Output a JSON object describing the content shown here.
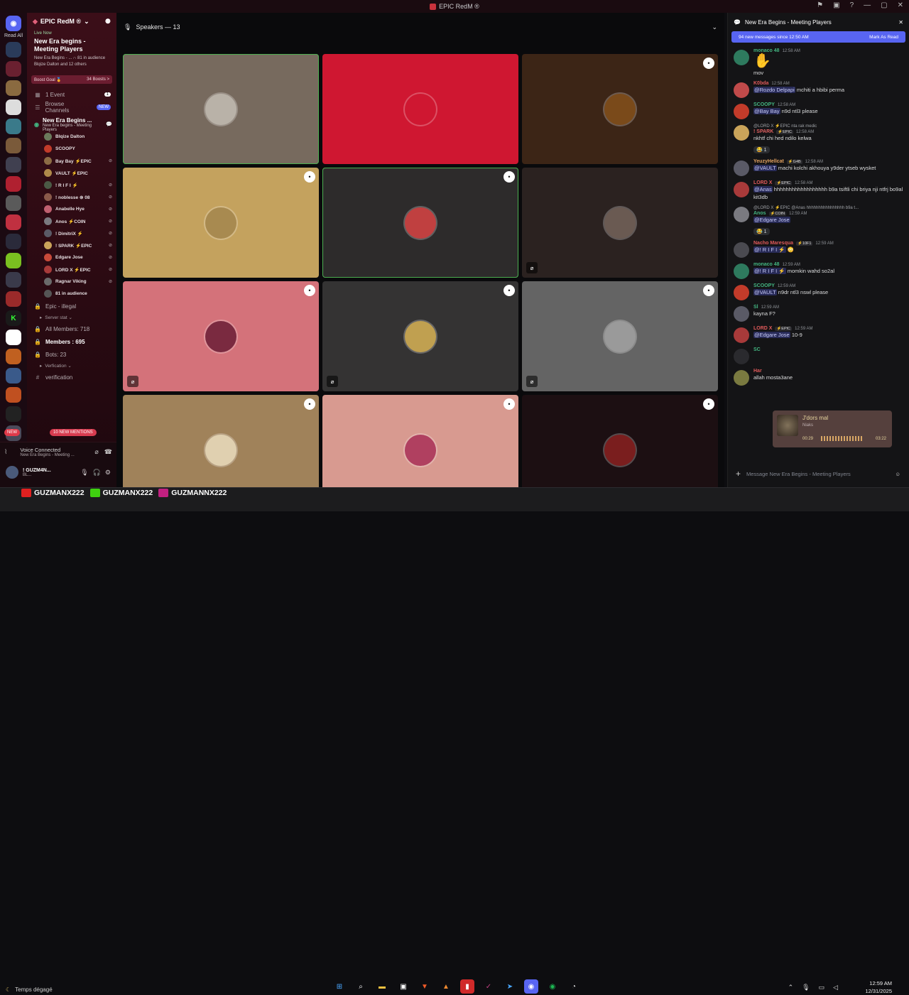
{
  "app": {
    "title": "EPIC RedM ®"
  },
  "guilds": {
    "read_all": "Read All"
  },
  "server": {
    "name": "EPIC RedM ®",
    "live": {
      "tag": "Live Now",
      "title": "New Era begins - Meeting Players",
      "meta": "New Era Begins - ... ∩ 81 in audience",
      "hosts": "Blqize Dalton and 12 others"
    },
    "boost": {
      "label": "Boost Goal 🏅",
      "count": "34 Boosts >"
    },
    "events": {
      "label": "1 Event",
      "count": "1"
    },
    "browse": {
      "label": "Browse Channels",
      "badge": "NEW"
    },
    "voice_channel": {
      "name": "New Era Begins ...",
      "sub": "New Era begins - Meeting Players"
    },
    "members": [
      {
        "name": "Blqize Dalton",
        "color": "#6b7a5c",
        "icons": ""
      },
      {
        "name": "SCOOPY",
        "color": "#c23b2a",
        "icons": ""
      },
      {
        "name": "Bay Bay ⚡EPIC",
        "color": "#8c6c45",
        "icons": "⊘"
      },
      {
        "name": "VAULT ⚡EPIC",
        "color": "#b08a4a",
        "icons": ""
      },
      {
        "name": "! R I F I ⚡",
        "color": "#4b5a45",
        "icons": "⊘"
      },
      {
        "name": "! noblesse ⊚ 08",
        "color": "#8a5a4a",
        "icons": "⊘"
      },
      {
        "name": "Anabelle Hye",
        "color": "#c06070",
        "icons": "⊘"
      },
      {
        "name": "Anos ⚡COIN",
        "color": "#7a7a80",
        "icons": "⊘"
      },
      {
        "name": "! DimitriX ⚡",
        "color": "#5a5a66",
        "icons": "⊘"
      },
      {
        "name": "! SPARK ⚡EPIC",
        "color": "#caa45a",
        "icons": "⊘"
      },
      {
        "name": "Edgare Jose",
        "color": "#c84a3a",
        "icons": "⊘"
      },
      {
        "name": "LORD X ⚡EPIC",
        "color": "#a83a3a",
        "icons": "⊘"
      },
      {
        "name": "Ragnar Viking",
        "color": "#6a6a6a",
        "icons": "⊘"
      },
      {
        "name": "81 in audience",
        "color": "#555",
        "icons": ""
      }
    ],
    "channels_below": [
      {
        "icon": "🔒",
        "label": "Epic - illegal"
      },
      {
        "icon": "▸",
        "label": "Server stat ⌄",
        "cat": true
      },
      {
        "icon": "🔒",
        "label": "All Members: 718"
      },
      {
        "icon": "🔒",
        "label": "Members : 695",
        "bold": true
      },
      {
        "icon": "🔒",
        "label": "Bots: 23"
      },
      {
        "icon": "▸",
        "label": "Verfication ⌄",
        "cat": true
      },
      {
        "icon": "#",
        "label": "verification"
      }
    ],
    "new_badge": "NEW",
    "mentions": "10 NEW MENTIONS"
  },
  "voice": {
    "status": "Voice Connected",
    "channel": "New Era Begins - Meeting ..."
  },
  "user": {
    "name": "! GUZM4N...",
    "status": "BL..."
  },
  "stage": {
    "header": "Speakers — 13",
    "tiles": [
      {
        "bg": "#776a5e",
        "speaking": true,
        "avatar_bg": "#b9b2a8",
        "menu": false,
        "mute": false
      },
      {
        "bg": "#cf1731",
        "speaking": false,
        "avatar_bg": "#cf1731",
        "menu": false,
        "mute": false
      },
      {
        "bg": "#3c2516",
        "speaking": false,
        "avatar_bg": "#7a4a1a",
        "menu": true,
        "mute": false
      },
      {
        "bg": "#c4a25e",
        "speaking": false,
        "avatar_bg": "#a88a50",
        "menu": true,
        "mute": false
      },
      {
        "bg": "#2d2b2b",
        "speaking": true,
        "avatar_bg": "#c04040",
        "menu": true,
        "mute": false
      },
      {
        "bg": "#2b2220",
        "speaking": false,
        "avatar_bg": "#6a5a52",
        "menu": false,
        "mute": true
      },
      {
        "bg": "#d4727a",
        "speaking": false,
        "avatar_bg": "#7a2a40",
        "menu": true,
        "mute": true
      },
      {
        "bg": "#343333",
        "speaking": false,
        "avatar_bg": "#c0a050",
        "menu": true,
        "mute": true
      },
      {
        "bg": "#646464",
        "speaking": false,
        "avatar_bg": "#9a9a9a",
        "menu": true,
        "mute": true
      },
      {
        "bg": "#a0825a",
        "speaking": false,
        "avatar_bg": "#e0d0b0",
        "menu": true,
        "mute": false
      },
      {
        "bg": "#d89a90",
        "speaking": false,
        "avatar_bg": "#b04060",
        "menu": true,
        "mute": false
      },
      {
        "bg": "#1c0f12",
        "speaking": false,
        "avatar_bg": "#7a1e1e",
        "menu": true,
        "mute": false
      }
    ]
  },
  "chat": {
    "title": "New Era Begins - Meeting Players",
    "new_messages": "94 new messages since 12:50 AM",
    "mark_read": "Mark As Read",
    "messages": [
      {
        "name": "monaco 48",
        "color": "#43b581",
        "time": "12:58 AM",
        "text": "mov",
        "emoji": "✋",
        "av": "#2e7a5e"
      },
      {
        "name": "K0bda",
        "color": "#e05a5a",
        "time": "12:58 AM",
        "mention": "@Rozdo Delpapi",
        "text": " mchiti a hbibi perma",
        "av": "#c04a4a"
      },
      {
        "name": "SCOOPY",
        "color": "#43b581",
        "time": "12:58 AM",
        "mention": "@Bay Bay",
        "text": " n9d ntl3 please",
        "av": "#c23b2a"
      },
      {
        "reply": "@LORD X ⚡EPIC  nta rak medic",
        "name": "! SPARK",
        "color": "#e06060",
        "tag": "⚡EPIC",
        "time": "12:58 AM",
        "text": "nkhtf chi hed ndilo kelwa",
        "react": "😂 1",
        "av": "#caa45a"
      },
      {
        "name": "YeuzyHellcat",
        "color": "#e0a060",
        "tag": "⚡G4B",
        "time": "12:58 AM",
        "mention": "@VAULT",
        "text": " machi kolchi akhouya y9der ytseb wysket",
        "av": "#5a5a66"
      },
      {
        "name": "LORD X",
        "color": "#e05a5a",
        "tag": "⚡EPIC",
        "time": "12:58 AM",
        "mention": "@Anas",
        "text": " hhhhhhhhhhhhhhhhhh b9a tsiftli chi briya nji ntfrj bo9al kit3db",
        "av": "#a83a3a"
      },
      {
        "reply": "@LORD X ⚡EPIC  @Anas hhhhhhhhhhhhhhhh b9a t...",
        "name": "Anos",
        "color": "#43b581",
        "tag": "⚡COIN",
        "time": "12:59 AM",
        "mention": "@Edgare Jose",
        "text": "",
        "react": "😂 1",
        "av": "#7a7a80"
      },
      {
        "name": "Nacho Maresqua",
        "color": "#e05a5a",
        "tag": "⚡10F1",
        "time": "12:59 AM",
        "mention": "@! R I F I ⚡",
        "text": " 😳",
        "av": "#4a4a50"
      },
      {
        "name": "monaco 48",
        "color": "#43b581",
        "time": "12:59 AM",
        "mention": "@! R I F I ⚡",
        "text": " momkin wahd so2al",
        "av": "#2e7a5e"
      },
      {
        "name": "SCOOPY",
        "color": "#43b581",
        "time": "12:59 AM",
        "mention": "@VAULT",
        "text": " n9dr ntl3 nswl please",
        "av": "#c23b2a"
      },
      {
        "name": "Sl",
        "color": "#43b581",
        "time": "12:59 AM",
        "text": "kayna F?",
        "av": "#5a5a66"
      },
      {
        "name": "LORD X",
        "color": "#e05a5a",
        "tag": "⚡EPIC",
        "time": "12:59 AM",
        "mention": "@Edgare Jose",
        "text": " 10-9",
        "av": "#a83a3a"
      },
      {
        "name": "SC",
        "color": "#43b581",
        "time": "",
        "text": "",
        "av": "#2a2a2e"
      },
      {
        "name": "Har",
        "color": "#e05a5a",
        "time": "",
        "text": "allah mosta3ane",
        "av": "#7a7a40"
      }
    ],
    "composer_placeholder": "Message New Era Begins - Meeting Players"
  },
  "now_playing": {
    "title": "J'dors mal",
    "artist": "Niaks",
    "elapsed": "00:29",
    "total": "03:22"
  },
  "overlay": {
    "items": [
      "GUZMANX222",
      "GUZMANX222",
      "GUZMANNX222"
    ]
  },
  "taskbar": {
    "weather": "Temps dégagé",
    "time": "12:59 AM",
    "date": "12/31/2025"
  }
}
